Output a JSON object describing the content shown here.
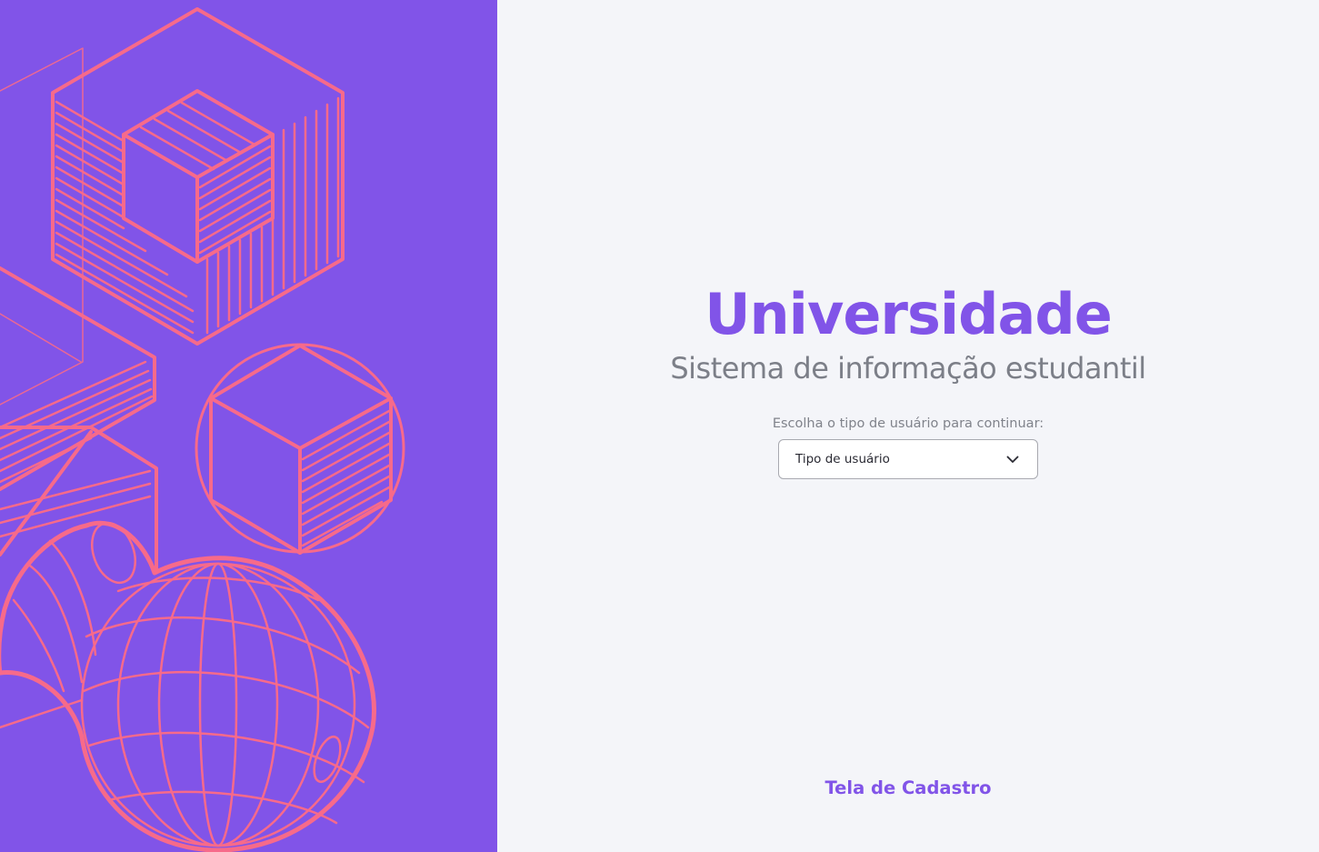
{
  "brand": {
    "title": "Universidade",
    "subtitle": "Sistema de informação estudantil"
  },
  "login": {
    "prompt": "Escolha o tipo de usuário para continuar:",
    "user_type_select": {
      "selected_label": "Tipo de usuário"
    }
  },
  "footer": {
    "register_link": "Tela de Cadastro"
  },
  "colors": {
    "accent": "#8154e8",
    "illustration_stroke": "#f76a8a",
    "background": "#f4f5f9",
    "muted_text": "#7c7f88"
  },
  "icons": {
    "select_chevron": "chevron-down-icon",
    "illustration": "geometric-shapes-illustration"
  }
}
